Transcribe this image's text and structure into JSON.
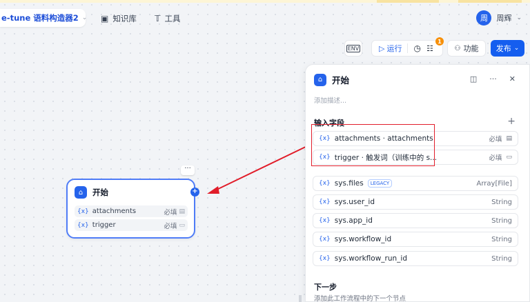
{
  "header": {
    "app_name": "e-tune 语料构造器2",
    "nav": [
      {
        "label": "知识库",
        "icon": "book-icon"
      },
      {
        "label": "工具",
        "icon": "tool-icon"
      }
    ],
    "user": {
      "avatar_text": "周",
      "name": "周辉"
    }
  },
  "toolbar": {
    "run_label": "运行",
    "checklist_badge": "1",
    "features_label": "功能",
    "publish_label": "发布"
  },
  "node": {
    "title": "开始",
    "more_label": "···",
    "fields": [
      {
        "name": "attachments",
        "required": "必填"
      },
      {
        "name": "trigger",
        "required": "必填"
      }
    ]
  },
  "panel": {
    "title": "开始",
    "description_placeholder": "添加描述...",
    "input_section_label": "输入字段",
    "user_fields": [
      {
        "name": "attachments · attachments",
        "required": "必填"
      },
      {
        "name": "trigger · 触发词（训练中的 s...",
        "required": "必填"
      }
    ],
    "system_fields": [
      {
        "name": "sys.files",
        "tag": "LEGACY",
        "type": "Array[File]"
      },
      {
        "name": "sys.user_id",
        "type": "String"
      },
      {
        "name": "sys.app_id",
        "type": "String"
      },
      {
        "name": "sys.workflow_id",
        "type": "String"
      },
      {
        "name": "sys.workflow_run_id",
        "type": "String"
      }
    ],
    "next_step_label": "下一步",
    "next_step_desc": "添加此工作流程中的下一个节点"
  },
  "var_prefix": "{x}",
  "colors": {
    "accent": "#155eef",
    "annotation": "#e11d2a",
    "badge": "#f79009"
  }
}
